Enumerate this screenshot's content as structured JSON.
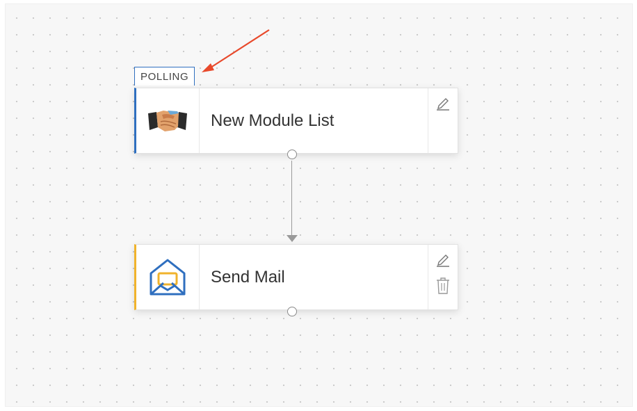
{
  "flow": {
    "trigger": {
      "tag": "POLLING",
      "title": "New Module List",
      "icon": "handshake-icon",
      "accent": "#2f6fbf"
    },
    "action": {
      "title": "Send Mail",
      "icon": "mail-icon",
      "accent": "#f0b32c"
    }
  },
  "colors": {
    "canvas": "#f7f7f7",
    "annotation": "#e8492b",
    "connector": "#9a9a9a"
  }
}
